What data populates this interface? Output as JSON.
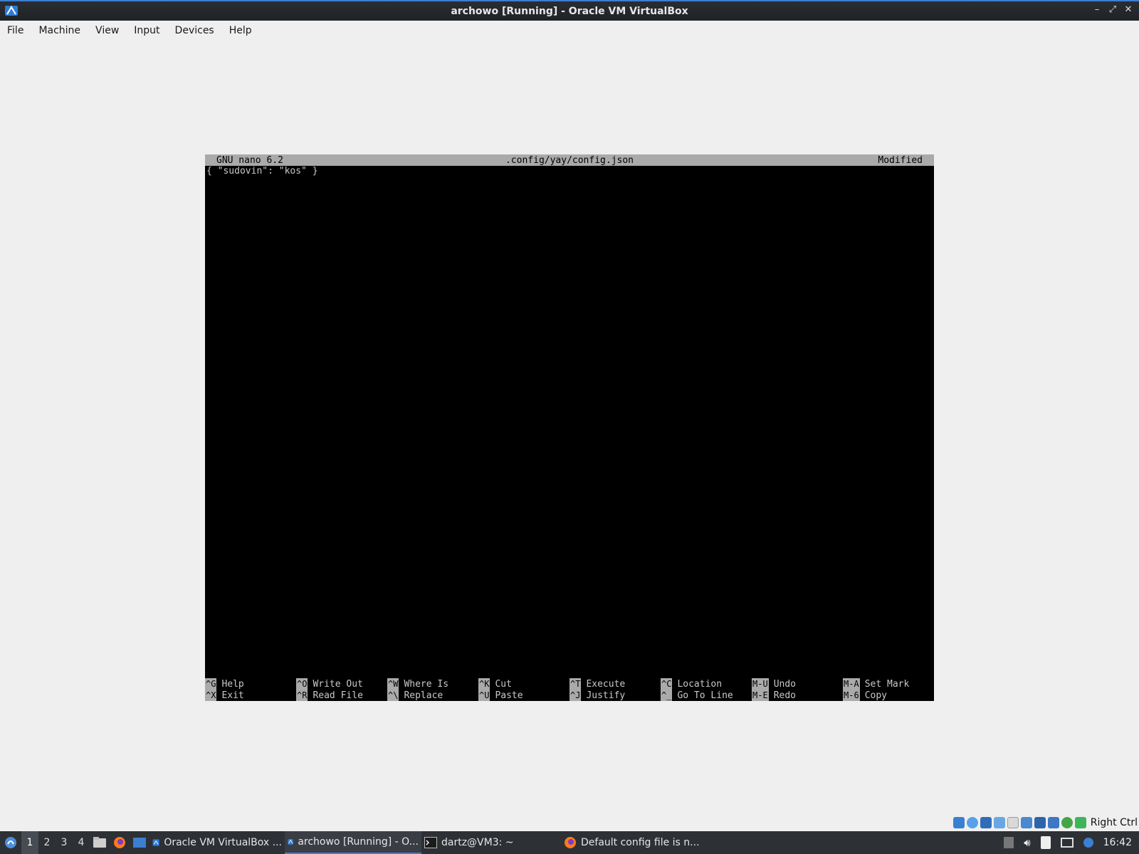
{
  "window": {
    "title": "archowo [Running] - Oracle VM VirtualBox",
    "controls": [
      "–",
      "⤢",
      "✕"
    ]
  },
  "menubar": [
    "File",
    "Machine",
    "View",
    "Input",
    "Devices",
    "Help"
  ],
  "nano": {
    "version": "GNU nano 6.2",
    "filename": ".config/yay/config.json",
    "status": "Modified",
    "content": "{ \"sudovin\": \"kos\" }",
    "shortcuts": [
      {
        "top_key": "^G",
        "top_label": "Help",
        "bottom_key": "^X",
        "bottom_label": "Exit"
      },
      {
        "top_key": "^O",
        "top_label": "Write Out",
        "bottom_key": "^R",
        "bottom_label": "Read File"
      },
      {
        "top_key": "^W",
        "top_label": "Where Is",
        "bottom_key": "^\\",
        "bottom_label": "Replace"
      },
      {
        "top_key": "^K",
        "top_label": "Cut",
        "bottom_key": "^U",
        "bottom_label": "Paste"
      },
      {
        "top_key": "^T",
        "top_label": "Execute",
        "bottom_key": "^J",
        "bottom_label": "Justify"
      },
      {
        "top_key": "^C",
        "top_label": "Location",
        "bottom_key": "^_",
        "bottom_label": "Go To Line"
      },
      {
        "top_key": "M-U",
        "top_label": "Undo",
        "bottom_key": "M-E",
        "bottom_label": "Redo"
      },
      {
        "top_key": "M-A",
        "top_label": "Set Mark",
        "bottom_key": "M-6",
        "bottom_label": "Copy"
      }
    ]
  },
  "vbox_status": {
    "host_key": "Right Ctrl",
    "icons": [
      "hard-disk-icon",
      "optical-drive-icon",
      "network-icon",
      "usb-icon",
      "shared-folder-icon",
      "display-icon",
      "video-capture-icon",
      "cpu-icon",
      "mouse-integration-icon",
      "keyboard-icon"
    ]
  },
  "taskbar": {
    "workspaces": [
      "1",
      "2",
      "3",
      "4"
    ],
    "active_workspace": 0,
    "tasks": [
      {
        "label": "Oracle VM VirtualBox ...",
        "icon": "virtualbox-icon"
      },
      {
        "label": "archowo [Running] - O...",
        "icon": "virtualbox-vm-icon",
        "active": true
      },
      {
        "label": "dartz@VM3: ~",
        "icon": "terminal-icon"
      },
      {
        "label": "Default config file is n...",
        "icon": "firefox-icon"
      }
    ],
    "clock": "16:42"
  },
  "colors": {
    "accent": "#3d7fd1",
    "taskbar_bg": "#2d3035",
    "nano_bar": "#aaaaaa"
  }
}
